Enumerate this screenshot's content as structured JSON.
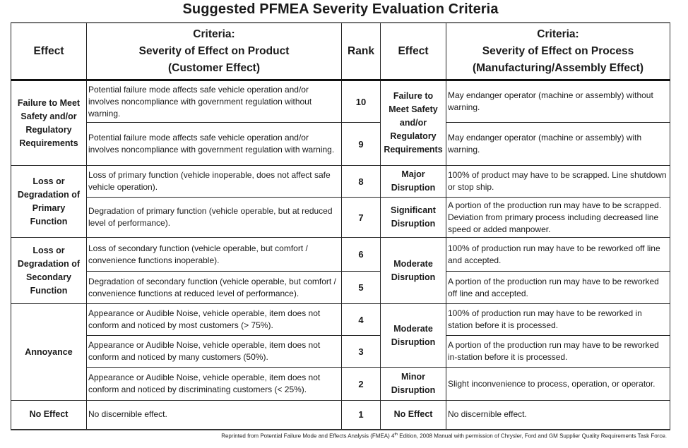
{
  "title": "Suggested PFMEA Severity Evaluation Criteria",
  "headers": {
    "effect_product": "Effect",
    "criteria_product_line1": "Criteria:",
    "criteria_product_line2": "Severity of Effect on Product",
    "criteria_product_line3": "(Customer Effect)",
    "rank": "Rank",
    "effect_process": "Effect",
    "criteria_process_line1": "Criteria:",
    "criteria_process_line2": "Severity of Effect on Process",
    "criteria_process_line3": "(Manufacturing/Assembly Effect)"
  },
  "product_effects": [
    "Failure to Meet Safety and/or Regulatory Requirements",
    "Loss or Degradation of Primary Function",
    "Loss or Degradation of Secondary Function",
    "Annoyance",
    "No Effect"
  ],
  "process_effects": [
    "Failure to Meet Safety and/or Regulatory Requirements",
    "Major Disruption",
    "Significant Disruption",
    "Moderate Disruption",
    "Moderate Disruption",
    "Minor Disruption",
    "No Effect"
  ],
  "rows": [
    {
      "rank": "10",
      "product_criteria": "Potential failure mode affects safe vehicle operation and/or involves noncompliance with government regulation without warning.",
      "process_criteria": "May endanger operator (machine or assembly) without warning."
    },
    {
      "rank": "9",
      "product_criteria": "Potential failure mode affects safe vehicle operation and/or involves noncompliance with government regulation with warning.",
      "process_criteria": "May endanger operator (machine or assembly) with warning."
    },
    {
      "rank": "8",
      "product_criteria": "Loss of primary function (vehicle inoperable, does not affect safe vehicle operation).",
      "process_criteria": "100% of product may have to be scrapped.  Line shutdown or stop ship."
    },
    {
      "rank": "7",
      "product_criteria": "Degradation of primary function (vehicle operable, but at reduced level of performance).",
      "process_criteria": "A portion of the production run may have to be scrapped. Deviation from primary process including decreased line speed or added manpower."
    },
    {
      "rank": "6",
      "product_criteria": "Loss of secondary function (vehicle operable, but comfort / convenience functions inoperable).",
      "process_criteria": "100% of production run may have to be reworked off line and accepted."
    },
    {
      "rank": "5",
      "product_criteria": "Degradation of secondary function (vehicle operable, but comfort / convenience functions at reduced level of performance).",
      "process_criteria": "A portion of the production run may have to be reworked off line and accepted."
    },
    {
      "rank": "4",
      "product_criteria": "Appearance or Audible Noise, vehicle operable, item does not conform and noticed by most customers (> 75%).",
      "process_criteria": "100% of production run may have to be reworked in station before it is processed."
    },
    {
      "rank": "3",
      "product_criteria": "Appearance or Audible Noise, vehicle operable, item does not conform and noticed by many customers (50%).",
      "process_criteria": "A portion of the production run may have to be reworked in-station before it is processed."
    },
    {
      "rank": "2",
      "product_criteria": "Appearance or Audible Noise, vehicle operable, item does not conform and noticed by discriminating customers (< 25%).",
      "process_criteria": "Slight inconvenience to process, operation, or operator."
    },
    {
      "rank": "1",
      "product_criteria": "No discernible effect.",
      "process_criteria": "No discernible effect."
    }
  ],
  "footnote": {
    "before_sup": "Reprinted from Potential Failure Mode and Effects Analysis (FMEA) 4",
    "sup": "th",
    "after_sup": " Edition, 2008 Manual with permission of Chrysler, Ford and GM Supplier Quality Requirements Task Force."
  }
}
